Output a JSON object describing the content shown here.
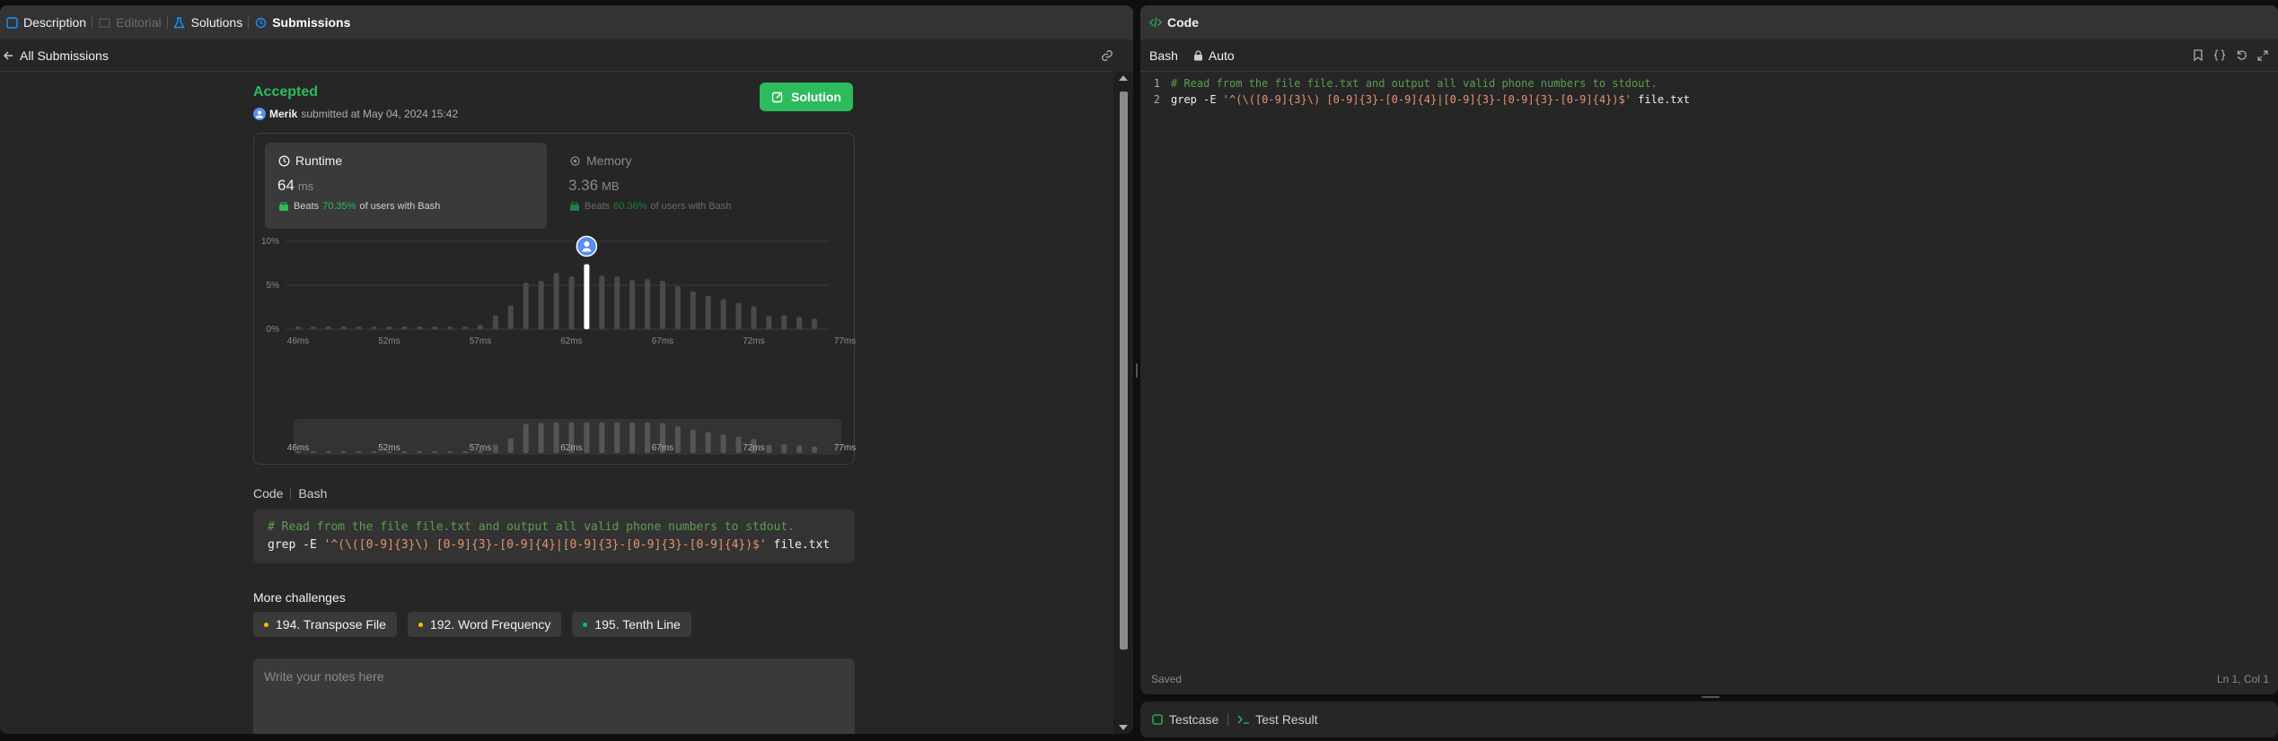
{
  "tabs": {
    "description": "Description",
    "editorial": "Editorial",
    "solutions": "Solutions",
    "submissions": "Submissions"
  },
  "subbar": {
    "back_label": "All Submissions"
  },
  "submission": {
    "status": "Accepted",
    "user": "Merik",
    "submitted_text": "submitted at May 04, 2024 15:42",
    "solution_button": "Solution"
  },
  "runtime": {
    "title": "Runtime",
    "value": "64",
    "unit": "ms",
    "beats_prefix": "Beats",
    "beats_pct": "70.35%",
    "beats_suffix": "of users with Bash"
  },
  "memory": {
    "title": "Memory",
    "value": "3.36",
    "unit": "MB",
    "beats_prefix": "Beats",
    "beats_pct": "60.36%",
    "beats_suffix": "of users with Bash"
  },
  "chart_data": {
    "type": "bar",
    "y_ticks": [
      "10%",
      "5%",
      "0%"
    ],
    "ylim": [
      0,
      10
    ],
    "x_tick_labels": [
      "46ms",
      "52ms",
      "57ms",
      "62ms",
      "67ms",
      "72ms",
      "77ms"
    ],
    "x_tick_index": [
      0,
      6,
      12,
      18,
      24,
      30,
      36
    ],
    "values": [
      0.3,
      0.3,
      0.3,
      0.3,
      0.3,
      0.3,
      0.3,
      0.3,
      0.3,
      0.3,
      0.3,
      0.3,
      0.5,
      1.6,
      2.7,
      5.3,
      5.5,
      6.4,
      6.0,
      7.4,
      6.1,
      6.0,
      5.6,
      5.7,
      5.5,
      4.9,
      4.3,
      3.8,
      3.4,
      3.0,
      2.6,
      1.5,
      1.6,
      1.4,
      1.2
    ],
    "highlight_index": 19,
    "highlight_color": "#ffffff",
    "bar_color": "#4a4a4a"
  },
  "code_section": {
    "label": "Code",
    "lang": "Bash",
    "line1": "# Read from the file file.txt and output all valid phone numbers to stdout.",
    "line2_cmd": "grep -E ",
    "line2_regex": "'^(\\([0-9]{3}\\) [0-9]{3}-[0-9]{4}|[0-9]{3}-[0-9]{3}-[0-9]{4})$'",
    "line2_file": " file.txt"
  },
  "more_challenges": {
    "title": "More challenges",
    "items": [
      {
        "label": "194. Transpose File",
        "color": "#ffb800"
      },
      {
        "label": "192. Word Frequency",
        "color": "#ffb800"
      },
      {
        "label": "195. Tenth Line",
        "color": "#00b8a3"
      }
    ]
  },
  "notes": {
    "placeholder": "Write your notes here"
  },
  "editor": {
    "title": "Code",
    "language": "Bash",
    "auto_label": "Auto",
    "line_numbers": [
      "1",
      "2"
    ],
    "saved": "Saved",
    "position": "Ln 1, Col 1"
  },
  "bottom": {
    "testcase": "Testcase",
    "test_result": "Test Result"
  },
  "colors": {
    "accent_green": "#2cbb5d",
    "panel_bg": "#262626"
  }
}
